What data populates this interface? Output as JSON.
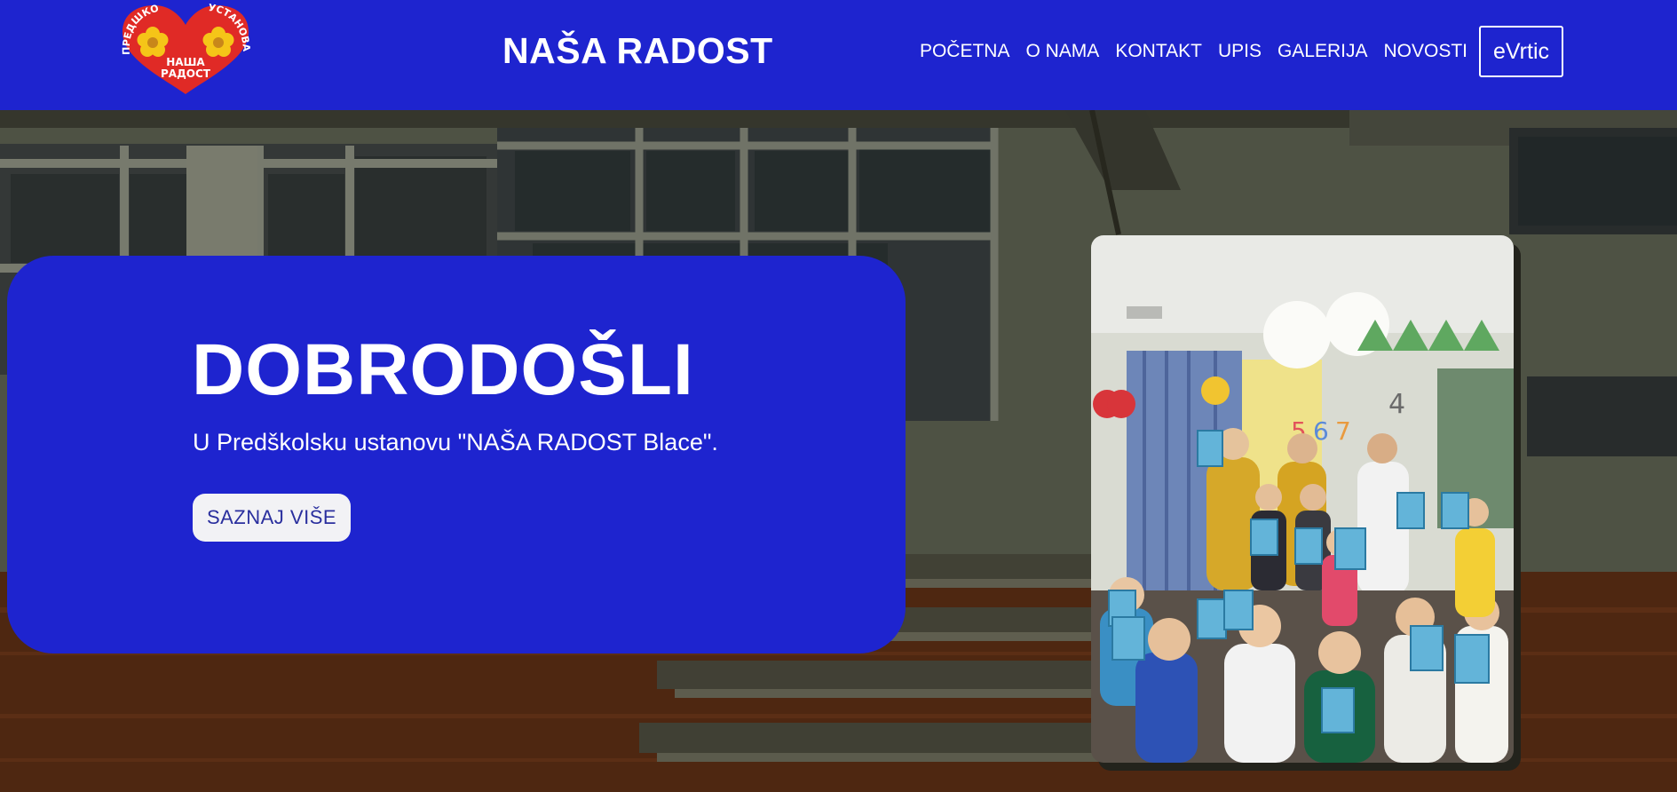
{
  "header": {
    "logo": {
      "text_top_left": "ПРЕДШКОЛСКА",
      "text_top_right": "УСТАНОВА",
      "text_center_1": "НАША",
      "text_center_2": "РАДОСТ"
    },
    "site_title": "NAŠA RADOST",
    "nav": [
      {
        "label": "POČETNA"
      },
      {
        "label": "O NAMA"
      },
      {
        "label": "KONTAKT"
      },
      {
        "label": "UPIS"
      },
      {
        "label": "GALERIJA"
      },
      {
        "label": "NOVOSTI"
      }
    ],
    "cta_label": "eVrtic"
  },
  "hero": {
    "title": "DOBRODOŠLI",
    "subtitle": "U Predškolsku ustanovu \"NAŠA RADOST Blace\".",
    "button_label": "SAZNAJ VIŠE"
  },
  "colors": {
    "brand_blue": "#1e24cf",
    "logo_red": "#e02a26",
    "logo_yellow": "#f5c518",
    "button_bg": "#f2f2f5",
    "button_text": "#2a2f9e"
  },
  "icons": {
    "logo": "heart-logo-icon",
    "hero_background": "school-building-image",
    "photo": "children-classroom-photo"
  }
}
